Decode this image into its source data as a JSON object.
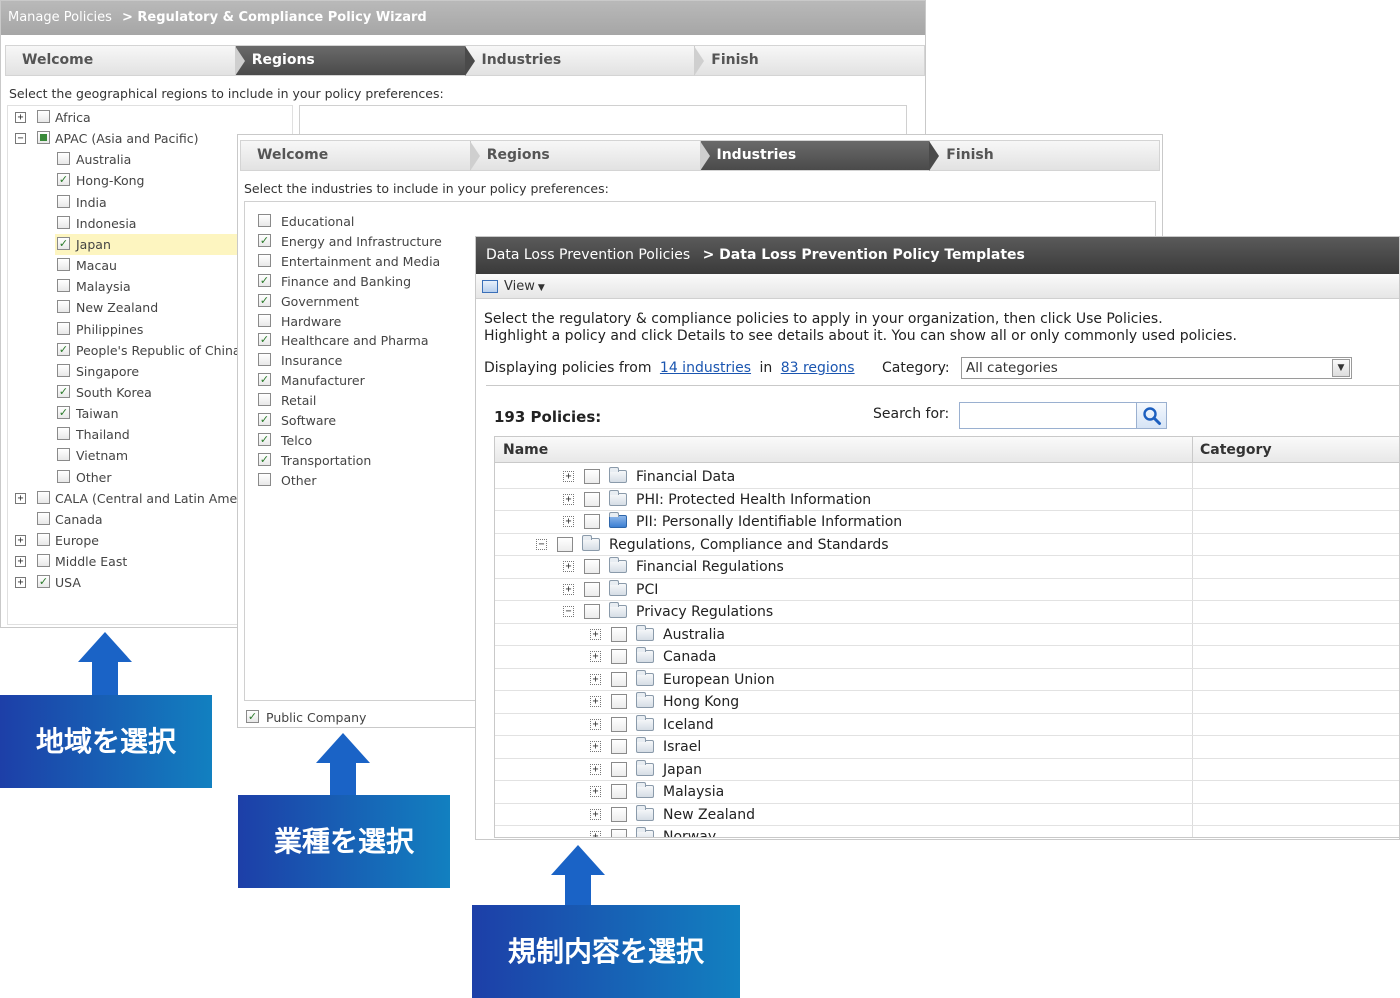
{
  "panel_regions": {
    "breadcrumb_root": "Manage Policies",
    "breadcrumb_current": "> Regulatory & Compliance Policy Wizard",
    "steps": [
      {
        "label": "Welcome",
        "active": false
      },
      {
        "label": "Regions",
        "active": true
      },
      {
        "label": "Industries",
        "active": false
      },
      {
        "label": "Finish",
        "active": false
      }
    ],
    "instruction": "Select the geographical regions to include in your policy preferences:",
    "tree": [
      {
        "label": "Africa",
        "level": 0,
        "expander": "+",
        "state": "none"
      },
      {
        "label": "APAC (Asia and Pacific)",
        "level": 0,
        "expander": "−",
        "state": "partial"
      },
      {
        "label": "Australia",
        "level": 1,
        "state": "none"
      },
      {
        "label": "Hong-Kong",
        "level": 1,
        "state": "checked"
      },
      {
        "label": "India",
        "level": 1,
        "state": "none"
      },
      {
        "label": "Indonesia",
        "level": 1,
        "state": "none"
      },
      {
        "label": "Japan",
        "level": 1,
        "state": "checked",
        "highlight": true
      },
      {
        "label": "Macau",
        "level": 1,
        "state": "none"
      },
      {
        "label": "Malaysia",
        "level": 1,
        "state": "none"
      },
      {
        "label": "New Zealand",
        "level": 1,
        "state": "none"
      },
      {
        "label": "Philippines",
        "level": 1,
        "state": "none"
      },
      {
        "label": "People's Republic of China",
        "level": 1,
        "state": "checked"
      },
      {
        "label": "Singapore",
        "level": 1,
        "state": "none"
      },
      {
        "label": "South Korea",
        "level": 1,
        "state": "checked"
      },
      {
        "label": "Taiwan",
        "level": 1,
        "state": "checked"
      },
      {
        "label": "Thailand",
        "level": 1,
        "state": "none"
      },
      {
        "label": "Vietnam",
        "level": 1,
        "state": "none"
      },
      {
        "label": "Other",
        "level": 1,
        "state": "none"
      },
      {
        "label": "CALA (Central and Latin America)",
        "level": 0,
        "expander": "+",
        "state": "none"
      },
      {
        "label": "Canada",
        "level": 0,
        "state": "none"
      },
      {
        "label": "Europe",
        "level": 0,
        "expander": "+",
        "state": "none"
      },
      {
        "label": "Middle East",
        "level": 0,
        "expander": "+",
        "state": "none"
      },
      {
        "label": "USA",
        "level": 0,
        "expander": "+",
        "state": "checked"
      }
    ]
  },
  "panel_industries": {
    "steps": [
      {
        "label": "Welcome",
        "active": false
      },
      {
        "label": "Regions",
        "active": false
      },
      {
        "label": "Industries",
        "active": true
      },
      {
        "label": "Finish",
        "active": false
      }
    ],
    "instruction": "Select the industries to include in your policy preferences:",
    "items": [
      {
        "label": "Educational",
        "checked": false
      },
      {
        "label": "Energy and Infrastructure",
        "checked": true
      },
      {
        "label": "Entertainment and Media",
        "checked": false
      },
      {
        "label": "Finance and Banking",
        "checked": true
      },
      {
        "label": "Government",
        "checked": true
      },
      {
        "label": "Hardware",
        "checked": false
      },
      {
        "label": "Healthcare and Pharma",
        "checked": true
      },
      {
        "label": "Insurance",
        "checked": false
      },
      {
        "label": "Manufacturer",
        "checked": true
      },
      {
        "label": "Retail",
        "checked": false
      },
      {
        "label": "Software",
        "checked": true
      },
      {
        "label": "Telco",
        "checked": true
      },
      {
        "label": "Transportation",
        "checked": true
      },
      {
        "label": "Other",
        "checked": false
      }
    ],
    "public_company": {
      "label": "Public Company",
      "checked": true
    }
  },
  "panel_dlp": {
    "breadcrumb_root": "Data Loss Prevention Policies",
    "breadcrumb_current": "> Data Loss Prevention Policy Templates",
    "view_menu": "View",
    "instruction_line1": "Select the regulatory & compliance policies to apply in your organization, then click Use Policies.",
    "instruction_line2": "Highlight a policy and click Details to see details about it. You can show all or only commonly used policies.",
    "displaying_prefix": "Displaying policies from",
    "industries_link": "14 industries",
    "in_word": "in",
    "regions_link": "83 regions",
    "category_label": "Category:",
    "category_value": "All categories",
    "policies_count": "193 Policies:",
    "search_label": "Search for:",
    "search_value": "",
    "columns": {
      "name": "Name",
      "category": "Category"
    },
    "rows": [
      {
        "label": "Financial Data",
        "level": 1,
        "expander": "+"
      },
      {
        "label": "PHI: Protected Health Information",
        "level": 1,
        "expander": "+"
      },
      {
        "label": "PII: Personally Identifiable Information",
        "level": 1,
        "expander": "+",
        "folder": "blue"
      },
      {
        "label": "Regulations, Compliance and Standards",
        "level": 0,
        "expander": "−"
      },
      {
        "label": "Financial Regulations",
        "level": 1,
        "expander": "+"
      },
      {
        "label": "PCI",
        "level": 1,
        "expander": "+"
      },
      {
        "label": "Privacy Regulations",
        "level": 1,
        "expander": "−"
      },
      {
        "label": "Australia",
        "level": 2,
        "expander": "+"
      },
      {
        "label": "Canada",
        "level": 2,
        "expander": "+"
      },
      {
        "label": "European Union",
        "level": 2,
        "expander": "+"
      },
      {
        "label": "Hong Kong",
        "level": 2,
        "expander": "+"
      },
      {
        "label": "Iceland",
        "level": 2,
        "expander": "+"
      },
      {
        "label": "Israel",
        "level": 2,
        "expander": "+"
      },
      {
        "label": "Japan",
        "level": 2,
        "expander": "+"
      },
      {
        "label": "Malaysia",
        "level": 2,
        "expander": "+"
      },
      {
        "label": "New Zealand",
        "level": 2,
        "expander": "+"
      },
      {
        "label": "Norway",
        "level": 2,
        "expander": "+"
      }
    ]
  },
  "callouts": [
    {
      "text": "地域を選択"
    },
    {
      "text": "業種を選択"
    },
    {
      "text": "規制内容を選択"
    }
  ],
  "colors": {
    "callout_blue": "#1a63c6",
    "link": "#1a55b0",
    "highlight": "#fdf5c0"
  }
}
